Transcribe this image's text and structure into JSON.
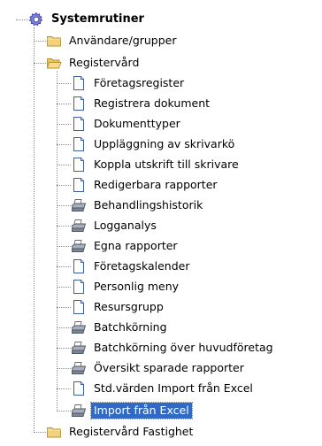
{
  "tree": {
    "root": {
      "label": "Systemrutiner",
      "icon": "gear-icon"
    },
    "nodes": [
      {
        "label": "Användare/grupper",
        "icon": "folder-icon"
      },
      {
        "label": "Registervård",
        "icon": "folder-open-icon"
      },
      {
        "label": "Registervård Fastighet",
        "icon": "folder-icon"
      }
    ],
    "children": [
      {
        "label": "Företagsregister",
        "icon": "document-icon"
      },
      {
        "label": "Registrera dokument",
        "icon": "document-icon"
      },
      {
        "label": "Dokumenttyper",
        "icon": "document-icon"
      },
      {
        "label": "Uppläggning av skrivarkö",
        "icon": "document-icon"
      },
      {
        "label": "Koppla utskrift till skrivare",
        "icon": "document-icon"
      },
      {
        "label": "Redigerbara rapporter",
        "icon": "document-icon"
      },
      {
        "label": "Behandlingshistorik",
        "icon": "printer-icon"
      },
      {
        "label": "Logganalys",
        "icon": "printer-icon"
      },
      {
        "label": "Egna rapporter",
        "icon": "printer-icon"
      },
      {
        "label": "Företagskalender",
        "icon": "document-icon"
      },
      {
        "label": "Personlig meny",
        "icon": "document-icon"
      },
      {
        "label": "Resursgrupp",
        "icon": "document-icon"
      },
      {
        "label": "Batchkörning",
        "icon": "printer-icon"
      },
      {
        "label": "Batchkörning över huvudföretag",
        "icon": "printer-icon"
      },
      {
        "label": "Översikt sparade rapporter",
        "icon": "printer-icon"
      },
      {
        "label": "Std.värden Import från Excel",
        "icon": "document-icon"
      },
      {
        "label": "Import från Excel",
        "icon": "printer-icon",
        "selected": true
      }
    ],
    "colors": {
      "selection": "#316ac5",
      "folder": "#f3d27a",
      "document": "#ffffff",
      "line": "#8c8c8c"
    }
  }
}
